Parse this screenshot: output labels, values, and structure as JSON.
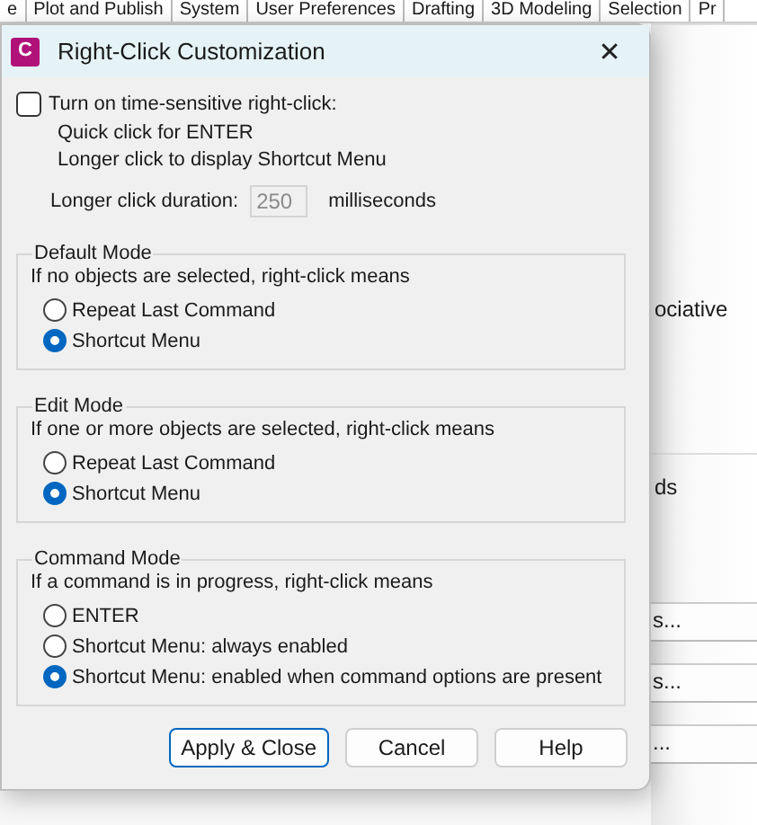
{
  "background_window": {
    "tabs": [
      {
        "label": "e"
      },
      {
        "label": "Plot and Publish"
      },
      {
        "label": "System"
      },
      {
        "label": "User Preferences"
      },
      {
        "label": "Drafting"
      },
      {
        "label": "3D Modeling"
      },
      {
        "label": "Selection"
      },
      {
        "label": "Pr"
      }
    ],
    "texts": [
      {
        "kind": "text",
        "label": "ociative"
      },
      {
        "kind": "text",
        "label": "ds"
      },
      {
        "kind": "button",
        "label": "s..."
      },
      {
        "kind": "button",
        "label": "s..."
      },
      {
        "kind": "button",
        "label": "..."
      }
    ]
  },
  "dialog": {
    "app_icon": {
      "letter": "C"
    },
    "title": "Right-Click Customization",
    "close": "✕",
    "time_sensitive": {
      "label": "Turn on time-sensitive right-click:",
      "checked": false,
      "lines": [
        "Quick click for ENTER",
        "Longer click to display Shortcut Menu"
      ]
    },
    "duration": {
      "label": "Longer click duration:",
      "value": "250",
      "disabled": true,
      "unit": "milliseconds"
    },
    "groups": [
      {
        "title": "Default Mode",
        "caption": "If no objects are selected, right-click means",
        "options": [
          {
            "label": "Repeat Last Command",
            "selected": false
          },
          {
            "label": "Shortcut Menu",
            "selected": true
          }
        ]
      },
      {
        "title": "Edit Mode",
        "caption": "If one or more objects are selected, right-click means",
        "options": [
          {
            "label": "Repeat Last Command",
            "selected": false
          },
          {
            "label": "Shortcut Menu",
            "selected": true
          }
        ]
      },
      {
        "title": "Command Mode",
        "caption": "If a command is in progress, right-click means",
        "options": [
          {
            "label": "ENTER",
            "selected": false
          },
          {
            "label": "Shortcut Menu: always enabled",
            "selected": false
          },
          {
            "label": "Shortcut Menu: enabled when command options are present",
            "selected": true
          }
        ]
      }
    ],
    "buttons": [
      {
        "label": "Apply & Close",
        "focused": true
      },
      {
        "label": "Cancel",
        "focused": false
      },
      {
        "label": "Help",
        "focused": false
      }
    ]
  }
}
